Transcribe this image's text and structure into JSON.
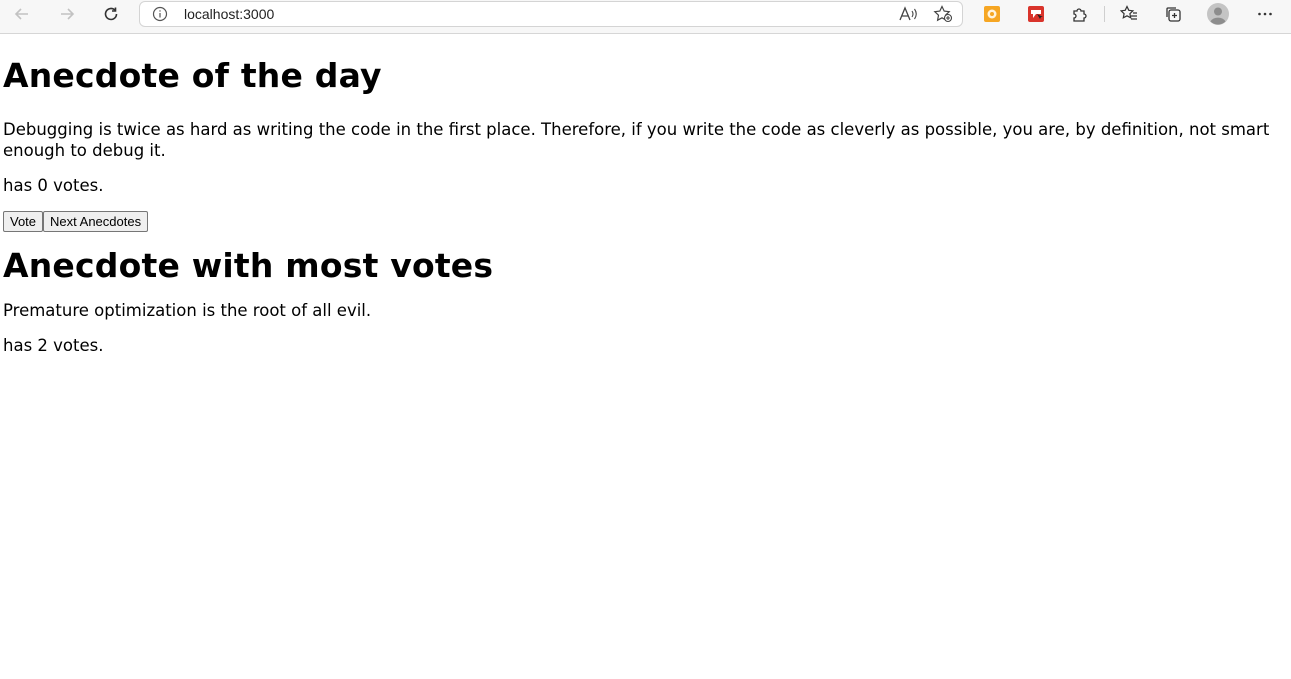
{
  "browser": {
    "url": "localhost:3000",
    "icons": {
      "back": "arrow-left-icon",
      "forward": "arrow-right-icon",
      "reload": "reload-icon",
      "info": "info-icon",
      "read_aloud": "read-aloud-icon",
      "add_favorite": "add-favorite-icon",
      "ext1": "extension-orange-icon",
      "ext2": "extension-red-icon",
      "extensions": "puzzle-icon",
      "favorites": "favorites-icon",
      "collections": "collections-icon",
      "profile": "avatar-icon",
      "more": "more-icon"
    },
    "colors": {
      "ext1": "#f6a623",
      "ext2": "#d9342b"
    }
  },
  "page": {
    "heading_day": "Anecdote of the day",
    "anecdote_text": "Debugging is twice as hard as writing the code in the first place. Therefore, if you write the code as cleverly as possible, you are, by definition, not smart enough to debug it.",
    "votes_text": "has 0 votes.",
    "vote_button": "Vote",
    "next_button": "Next Anecdotes",
    "heading_most": "Anecdote with most votes",
    "most_text": "Premature optimization is the root of all evil.",
    "most_votes_text": "has 2 votes."
  }
}
